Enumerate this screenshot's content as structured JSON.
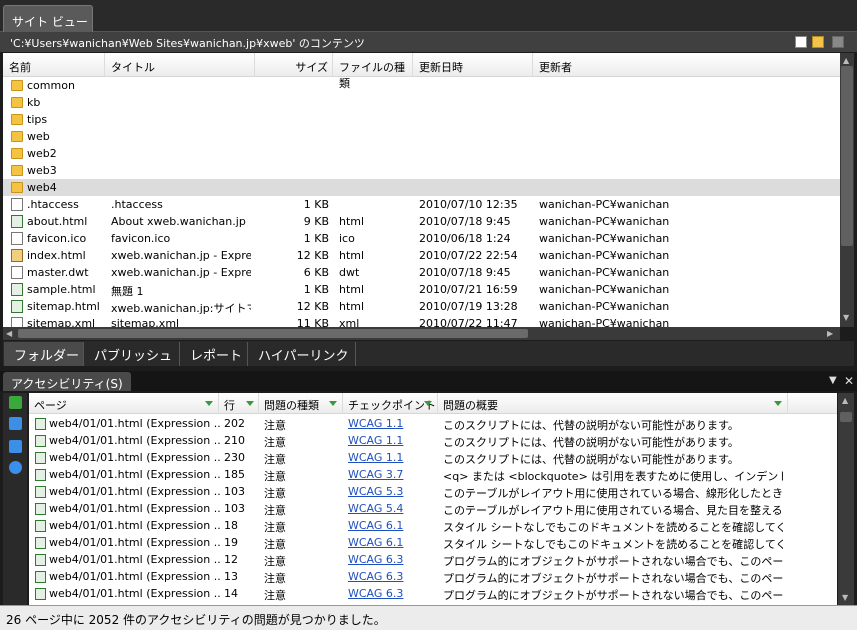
{
  "site_view": {
    "tab_label": "サイト ビュー",
    "path": "'C:¥Users¥wanichan¥Web Sites¥wanichan.jp¥xweb' のコンテンツ",
    "columns": [
      "名前",
      "タイトル",
      "サイズ",
      "ファイルの種類",
      "更新日時",
      "更新者"
    ],
    "rows": [
      {
        "name": "common",
        "title": "",
        "size": "",
        "type": "",
        "date": "",
        "author": "",
        "icon": "folder-icon"
      },
      {
        "name": "kb",
        "title": "",
        "size": "",
        "type": "",
        "date": "",
        "author": "",
        "icon": "folder-icon"
      },
      {
        "name": "tips",
        "title": "",
        "size": "",
        "type": "",
        "date": "",
        "author": "",
        "icon": "folder-icon"
      },
      {
        "name": "web",
        "title": "",
        "size": "",
        "type": "",
        "date": "",
        "author": "",
        "icon": "folder-icon"
      },
      {
        "name": "web2",
        "title": "",
        "size": "",
        "type": "",
        "date": "",
        "author": "",
        "icon": "folder-icon"
      },
      {
        "name": "web3",
        "title": "",
        "size": "",
        "type": "",
        "date": "",
        "author": "",
        "icon": "folder-icon"
      },
      {
        "name": "web4",
        "title": "",
        "size": "",
        "type": "",
        "date": "",
        "author": "",
        "icon": "folder-icon",
        "selected": true
      },
      {
        "name": ".htaccess",
        "title": ".htaccess",
        "size": "1 KB",
        "type": "",
        "date": "2010/07/10 12:35",
        "author": "wanichan-PC¥wanichan",
        "icon": "file-icon"
      },
      {
        "name": "about.html",
        "title": "About xweb.wanichan.jp",
        "size": "9 KB",
        "type": "html",
        "date": "2010/07/18 9:45",
        "author": "wanichan-PC¥wanichan",
        "icon": "html-file-icon"
      },
      {
        "name": "favicon.ico",
        "title": "favicon.ico",
        "size": "1 KB",
        "type": "ico",
        "date": "2010/06/18 1:24",
        "author": "wanichan-PC¥wanichan",
        "icon": "file-icon"
      },
      {
        "name": "index.html",
        "title": "xweb.wanichan.jp - Expre...",
        "size": "12 KB",
        "type": "html",
        "date": "2010/07/22 22:54",
        "author": "wanichan-PC¥wanichan",
        "icon": "home-page-icon"
      },
      {
        "name": "master.dwt",
        "title": "xweb.wanichan.jp - Expre...",
        "size": "6 KB",
        "type": "dwt",
        "date": "2010/07/18 9:45",
        "author": "wanichan-PC¥wanichan",
        "icon": "file-icon"
      },
      {
        "name": "sample.html",
        "title": "無題 1",
        "size": "1 KB",
        "type": "html",
        "date": "2010/07/21 16:59",
        "author": "wanichan-PC¥wanichan",
        "icon": "html-file-icon"
      },
      {
        "name": "sitemap.html",
        "title": "xweb.wanichan.jp:サイトマ...",
        "size": "12 KB",
        "type": "html",
        "date": "2010/07/19 13:28",
        "author": "wanichan-PC¥wanichan",
        "icon": "html-file-icon"
      },
      {
        "name": "sitemap.xml",
        "title": "sitemap.xml",
        "size": "11 KB",
        "type": "xml",
        "date": "2010/07/22 11:47",
        "author": "wanichan-PC¥wanichan",
        "icon": "file-icon"
      }
    ],
    "bottom_tabs": [
      "フォルダー",
      "パブリッシュ",
      "レポート",
      "ハイパーリンク"
    ]
  },
  "accessibility": {
    "tab_label": "アクセシビリティ(S)",
    "columns": [
      "ページ",
      "行",
      "問題の種類",
      "チェックポイント",
      "問題の概要"
    ],
    "rows": [
      {
        "page": "web4/01/01.html (Expression ...",
        "line": "202",
        "kind": "注意",
        "checkpoint": "WCAG 1.1",
        "summary": "このスクリプトには、代替の説明がない可能性があります。"
      },
      {
        "page": "web4/01/01.html (Expression ...",
        "line": "210",
        "kind": "注意",
        "checkpoint": "WCAG 1.1",
        "summary": "このスクリプトには、代替の説明がない可能性があります。"
      },
      {
        "page": "web4/01/01.html (Expression ...",
        "line": "230",
        "kind": "注意",
        "checkpoint": "WCAG 1.1",
        "summary": "このスクリプトには、代替の説明がない可能性があります。"
      },
      {
        "page": "web4/01/01.html (Expression ...",
        "line": "185",
        "kind": "注意",
        "checkpoint": "WCAG 3.7",
        "summary": "<q> または <blockquote> は引用を表すために使用し、インデント目的..."
      },
      {
        "page": "web4/01/01.html (Expression ...",
        "line": "103",
        "kind": "注意",
        "checkpoint": "WCAG 5.3",
        "summary": "このテーブルがレイアウト用に使用されている場合、線形化したときに意..."
      },
      {
        "page": "web4/01/01.html (Expression ...",
        "line": "103",
        "kind": "注意",
        "checkpoint": "WCAG 5.4",
        "summary": "このテーブルがレイアウト用に使用されている場合、見た目を整えるため..."
      },
      {
        "page": "web4/01/01.html (Expression ...",
        "line": "18",
        "kind": "注意",
        "checkpoint": "WCAG 6.1",
        "summary": "スタイル シートなしでもこのドキュメントを読めることを確認してください。"
      },
      {
        "page": "web4/01/01.html (Expression ...",
        "line": "19",
        "kind": "注意",
        "checkpoint": "WCAG 6.1",
        "summary": "スタイル シートなしでもこのドキュメントを読めることを確認してください。"
      },
      {
        "page": "web4/01/01.html (Expression ...",
        "line": "12",
        "kind": "注意",
        "checkpoint": "WCAG 6.3",
        "summary": "プログラム的にオブジェクトがサポートされない場合でも、このページが利..."
      },
      {
        "page": "web4/01/01.html (Expression ...",
        "line": "13",
        "kind": "注意",
        "checkpoint": "WCAG 6.3",
        "summary": "プログラム的にオブジェクトがサポートされない場合でも、このページが利..."
      },
      {
        "page": "web4/01/01.html (Expression ...",
        "line": "14",
        "kind": "注意",
        "checkpoint": "WCAG 6.3",
        "summary": "プログラム的にオブジェクトがサポートされない場合でも、このページが利..."
      }
    ],
    "status": "26 ページ中に 2052 件のアクセシビリティの問題が見つかりました。"
  },
  "colors": {
    "link": "#1f4fbf",
    "folder": "#f5c342",
    "accent_green": "#3a9a3a"
  }
}
